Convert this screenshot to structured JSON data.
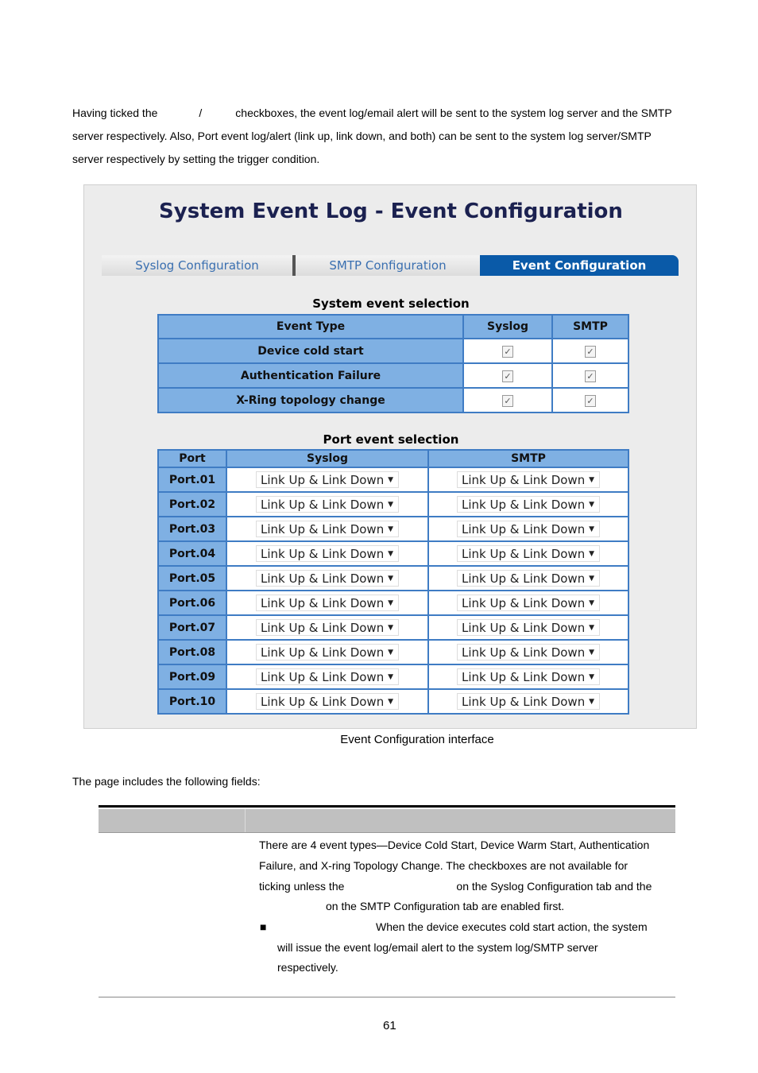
{
  "intro": {
    "l1a": "Having ticked the",
    "l1b": "/",
    "l1c": "checkboxes, the event log/email alert will be sent to the system log server and the SMTP",
    "l2": "server respectively. Also, Port event log/alert (link up, link down, and both) can be sent to the system log server/SMTP",
    "l3": "server respectively by setting the trigger condition."
  },
  "screen": {
    "title": "System Event Log - Event Configuration",
    "tabs": [
      {
        "label": "Syslog Configuration",
        "active": false
      },
      {
        "label": "SMTP Configuration",
        "active": false
      },
      {
        "label": "Event Configuration",
        "active": true
      }
    ],
    "system_section": "System event selection",
    "system_headers": [
      "Event Type",
      "Syslog",
      "SMTP"
    ],
    "system_rows": [
      {
        "event": "Device cold start",
        "syslog": true,
        "smtp": true
      },
      {
        "event": "Authentication Failure",
        "syslog": true,
        "smtp": true
      },
      {
        "event": "X-Ring topology change",
        "syslog": true,
        "smtp": true
      }
    ],
    "port_section": "Port event selection",
    "port_headers": [
      "Port",
      "Syslog",
      "SMTP"
    ],
    "port_rows": [
      {
        "port": "Port.01",
        "syslog": "Link Up & Link Down",
        "smtp": "Link Up & Link Down"
      },
      {
        "port": "Port.02",
        "syslog": "Link Up & Link Down",
        "smtp": "Link Up & Link Down"
      },
      {
        "port": "Port.03",
        "syslog": "Link Up & Link Down",
        "smtp": "Link Up & Link Down"
      },
      {
        "port": "Port.04",
        "syslog": "Link Up & Link Down",
        "smtp": "Link Up & Link Down"
      },
      {
        "port": "Port.05",
        "syslog": "Link Up & Link Down",
        "smtp": "Link Up & Link Down"
      },
      {
        "port": "Port.06",
        "syslog": "Link Up & Link Down",
        "smtp": "Link Up & Link Down"
      },
      {
        "port": "Port.07",
        "syslog": "Link Up & Link Down",
        "smtp": "Link Up & Link Down"
      },
      {
        "port": "Port.08",
        "syslog": "Link Up & Link Down",
        "smtp": "Link Up & Link Down"
      },
      {
        "port": "Port.09",
        "syslog": "Link Up & Link Down",
        "smtp": "Link Up & Link Down"
      },
      {
        "port": "Port.10",
        "syslog": "Link Up & Link Down",
        "smtp": "Link Up & Link Down"
      }
    ],
    "colors": {
      "tab_active": "#0a5aa8",
      "cell_blue": "#7fb0e3",
      "border": "#3f7cc4"
    }
  },
  "caption": "Event Configuration interface",
  "fields_intro": "The page includes the following fields:",
  "fields": {
    "d1": "There are 4 event types—Device Cold Start, Device Warm Start, Authentication",
    "d2": "Failure, and X-ring Topology Change. The checkboxes are not available for",
    "d3a": "ticking unless the",
    "d3b": "on the Syslog Configuration tab and the",
    "d4": "on the SMTP Configuration tab are enabled first.",
    "b1": "When the device executes cold start action, the system",
    "b2": "will issue the event log/email alert to the system log/SMTP server",
    "b3": "respectively."
  },
  "page_number": "61"
}
